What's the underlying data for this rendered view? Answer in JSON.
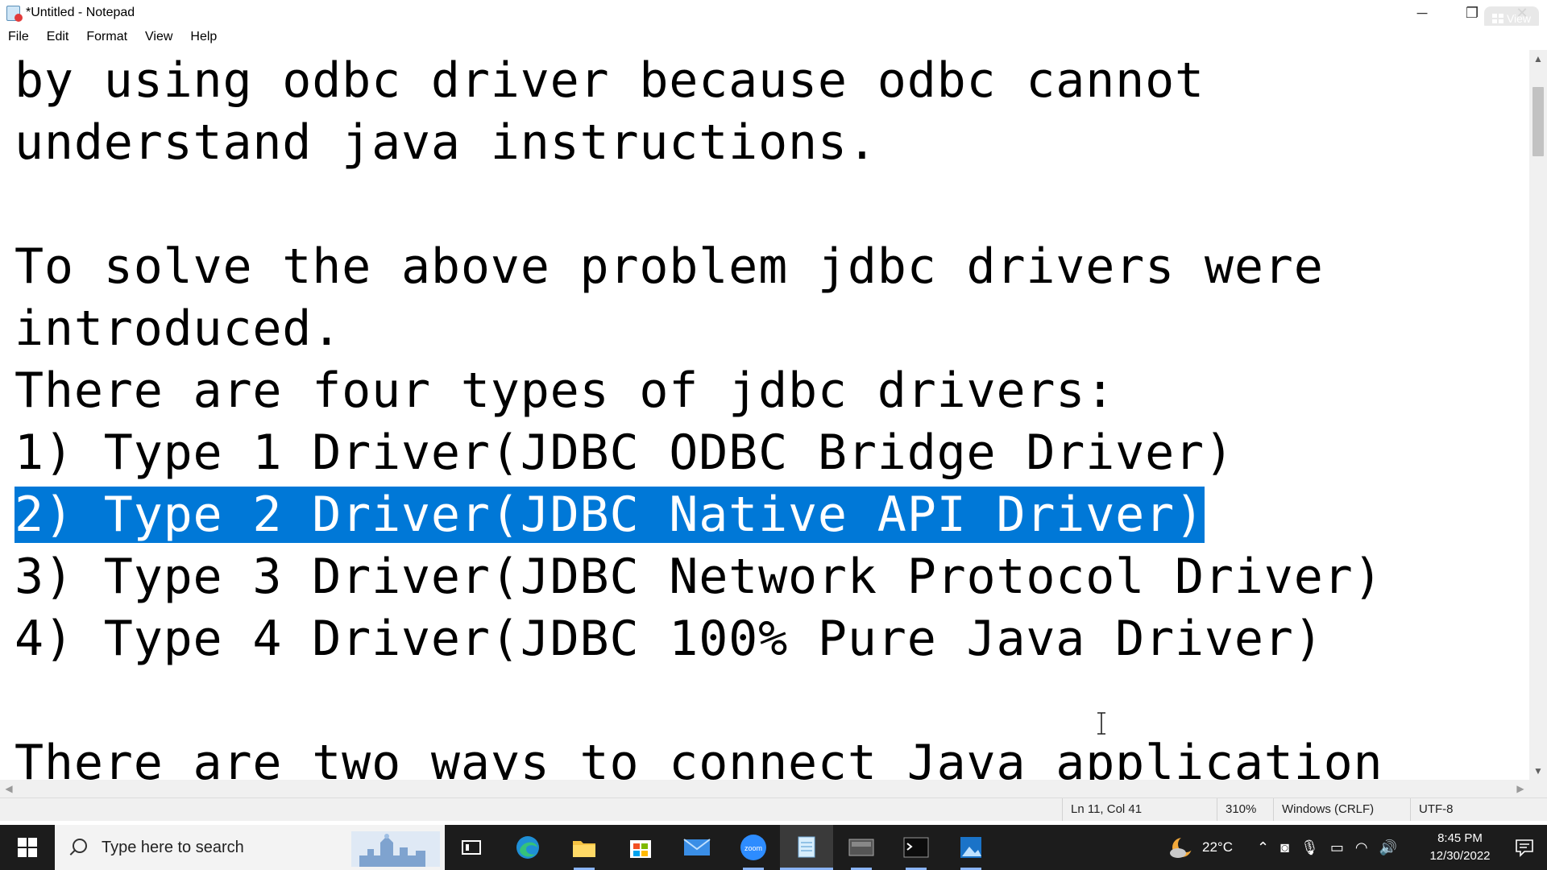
{
  "window": {
    "title": "*Untitled - Notepad",
    "minimize": "─",
    "restore": "❐",
    "close": "✕",
    "view_chip": "View"
  },
  "menu": [
    "File",
    "Edit",
    "Format",
    "View",
    "Help"
  ],
  "editor": {
    "lines": [
      "by using odbc driver because odbc cannot",
      "understand java instructions.",
      "",
      "To solve the above problem jdbc drivers were",
      "introduced.",
      "There are four types of jdbc drivers:",
      "1) Type 1 Driver(JDBC ODBC Bridge Driver)",
      "2) Type 2 Driver(JDBC Native API Driver)",
      "3) Type 3 Driver(JDBC Network Protocol Driver)",
      "4) Type 4 Driver(JDBC 100% Pure Java Driver)",
      "",
      "There are two ways to connect Java application"
    ],
    "selected_line_index": 7,
    "selection_color": "#0078d7"
  },
  "statusbar": {
    "position": "Ln 11, Col 41",
    "zoom": "310%",
    "line_ending": "Windows (CRLF)",
    "encoding": "UTF-8"
  },
  "taskbar": {
    "search_placeholder": "Type here to search",
    "weather_temp": "22°C",
    "time": "8:45 PM",
    "date": "12/30/2022",
    "icons": [
      "task-view-icon",
      "edge-icon",
      "file-explorer-icon",
      "store-icon",
      "mail-icon",
      "zoom-icon",
      "notepad-icon",
      "app-icon",
      "terminal-icon",
      "photos-icon"
    ]
  }
}
